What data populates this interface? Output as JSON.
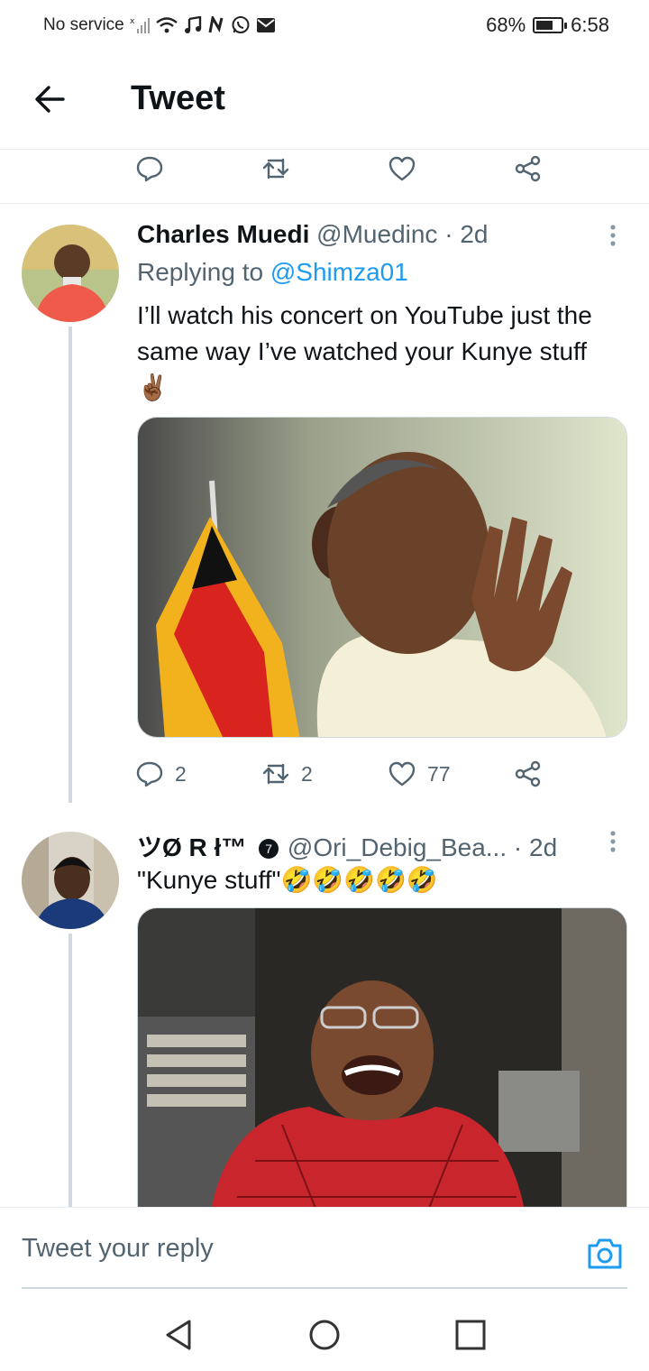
{
  "status_bar": {
    "carrier": "No service",
    "battery": "68%",
    "battery_level": 0.68,
    "time": "6:58"
  },
  "header": {
    "title": "Tweet",
    "back_icon": "arrow-left-icon"
  },
  "top_actions": {
    "icons": [
      "reply-icon",
      "retweet-icon",
      "like-icon",
      "share-icon"
    ]
  },
  "tweets": [
    {
      "name": "Charles Muedi",
      "handle": "@Muedinc",
      "time": "· 2d",
      "replying_prefix": "Replying to",
      "replying_to": "@Shimza01",
      "text": "I’ll watch his concert on YouTube just the same way I’ve watched your Kunye stuff ✌🏾",
      "replies": "2",
      "retweets": "2",
      "likes": "77"
    },
    {
      "name": "ツØ R ł™",
      "badge": "7",
      "handle": "@Ori_Debig_Bea...",
      "time": "· 2d",
      "text": "\"Kunye stuff\"🤣🤣🤣🤣🤣"
    }
  ],
  "reply_bar": {
    "placeholder": "Tweet your reply",
    "camera_icon": "camera-icon"
  },
  "nav_bar": {
    "icons": [
      "nav-back-icon",
      "nav-home-icon",
      "nav-recents-icon"
    ]
  },
  "colors": {
    "link": "#1d9bf0",
    "muted": "#536471",
    "divider": "#e6ecf0"
  }
}
